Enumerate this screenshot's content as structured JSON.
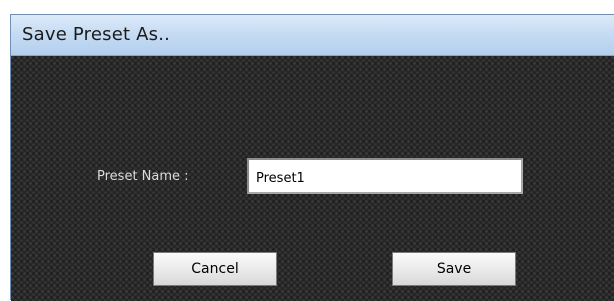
{
  "dialog": {
    "title": "Save Preset As..",
    "preset_name_label": "Preset Name :",
    "preset_name_value": "Preset1",
    "cancel_label": "Cancel",
    "save_label": "Save"
  },
  "colors": {
    "titlebar": "#c6dcf3",
    "client_background": "#262626",
    "label_text": "#dcdcdc"
  }
}
